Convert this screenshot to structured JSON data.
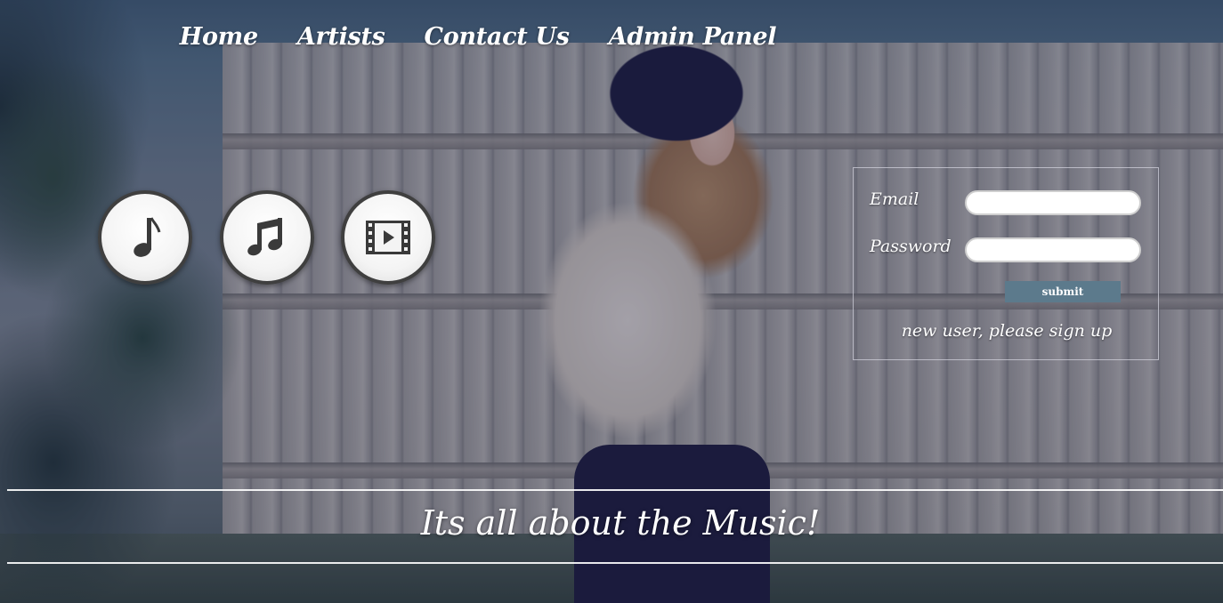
{
  "nav": {
    "items": [
      {
        "label": "Home"
      },
      {
        "label": "Artists"
      },
      {
        "label": "Contact Us"
      },
      {
        "label": "Admin Panel"
      }
    ]
  },
  "icons": [
    {
      "name": "music-note-icon"
    },
    {
      "name": "music-notes-icon"
    },
    {
      "name": "video-film-icon"
    }
  ],
  "login": {
    "email_label": "Email",
    "email_value": "",
    "password_label": "Password",
    "password_value": "",
    "submit_label": "submit",
    "signup_text": "new user, please sign up"
  },
  "tagline": "Its all about the Music!",
  "colors": {
    "submit_bg": "#5c7a8c",
    "icon_border": "#3f3f3f",
    "text": "#ffffff"
  }
}
